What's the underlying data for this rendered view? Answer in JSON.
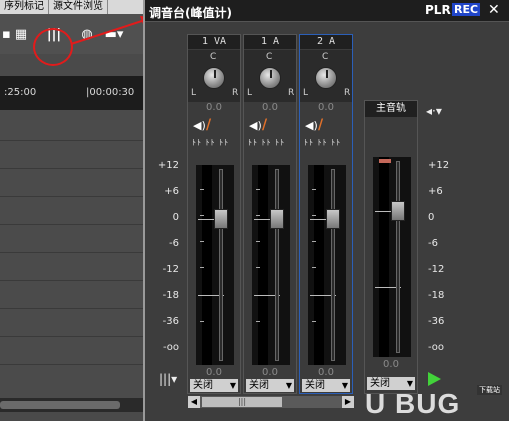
{
  "left": {
    "tabs": [
      "序列标记",
      "源文件浏览"
    ],
    "ruler": [
      ":25:00",
      "|00:00:30"
    ],
    "icons": [
      "list-icon",
      "grid-icon",
      "mixer-icon",
      "color-icon",
      "monitor-icon"
    ]
  },
  "mixer": {
    "title": "调音台(峰值计)",
    "plr": "PLR",
    "rec": "REC",
    "close": "✕",
    "channels": [
      {
        "name": "1 VA",
        "pan": "0.0",
        "volume": "0.0",
        "output": "关闭"
      },
      {
        "name": "1 A",
        "pan": "0.0",
        "volume": "0.0",
        "output": "关闭"
      },
      {
        "name": "2 A",
        "pan": "0.0",
        "volume": "0.0",
        "output": "关闭"
      }
    ],
    "knob": {
      "center": "C",
      "left": "L",
      "right": "R"
    },
    "fx": "ﾄﾄ ﾄﾄ ﾄﾄ",
    "master": {
      "name": "主音轨",
      "volume": "0.0",
      "output": "关闭"
    },
    "scale": [
      "+12",
      "+6",
      "0",
      "-6",
      "-12",
      "-18",
      "-36",
      "-oo"
    ],
    "scrollbar": "|||"
  },
  "watermark": {
    "brand": "U BUG",
    "sub": "下载站"
  }
}
